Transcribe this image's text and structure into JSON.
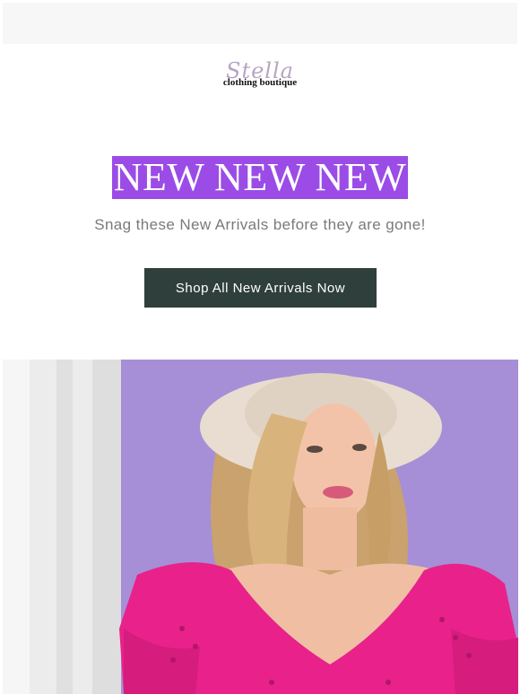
{
  "brand": {
    "script_name": "Stella",
    "subtitle": "clothing boutique"
  },
  "headline": "NEW NEW NEW",
  "subheadline": "Snag these New Arrivals before they are gone!",
  "cta": {
    "label": "Shop All New Arrivals Now"
  },
  "colors": {
    "headline_bg": "#9b4ce6",
    "cta_bg": "#2f3f3c",
    "hero_bg": "#a68fd6",
    "top_dress": "#e8228a"
  },
  "hero_image": {
    "subject": "model-wearing-wide-brim-hat-and-pink-eyelet-top"
  }
}
